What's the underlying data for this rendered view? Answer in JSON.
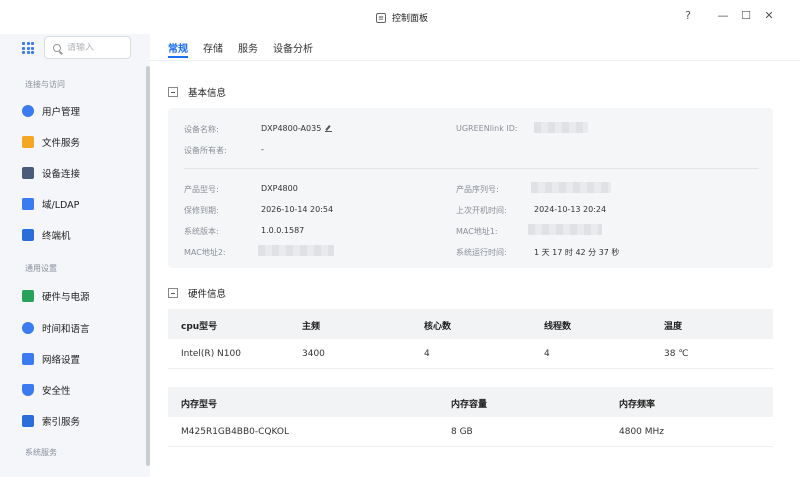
{
  "window": {
    "title": "控制面板"
  },
  "window_controls": {
    "help": "?",
    "minimize": "—",
    "maximize": "☐",
    "close": "✕"
  },
  "sidebar": {
    "search_placeholder": "请输入",
    "sections": [
      {
        "label": "连接与访问",
        "items": [
          {
            "label": "用户管理",
            "icon": "user-icon",
            "color": "#3a7bf0"
          },
          {
            "label": "文件服务",
            "icon": "folder-icon",
            "color": "#f5a623"
          },
          {
            "label": "设备连接",
            "icon": "device-icon",
            "color": "#4a5a7a"
          },
          {
            "label": "域/LDAP",
            "icon": "domain-icon",
            "color": "#3a7bf0"
          },
          {
            "label": "终端机",
            "icon": "terminal-icon",
            "color": "#2b6ed9"
          }
        ]
      },
      {
        "label": "通用设置",
        "items": [
          {
            "label": "硬件与电源",
            "icon": "power-icon",
            "color": "#27a35b"
          },
          {
            "label": "时间和语言",
            "icon": "clock-icon",
            "color": "#3a7bf0"
          },
          {
            "label": "网络设置",
            "icon": "network-icon",
            "color": "#3a7bf0"
          },
          {
            "label": "安全性",
            "icon": "shield-icon",
            "color": "#3a7bf0"
          },
          {
            "label": "索引服务",
            "icon": "index-icon",
            "color": "#2b6ed9"
          }
        ]
      },
      {
        "label": "系统服务",
        "items": []
      }
    ]
  },
  "tabs": [
    {
      "label": "常规",
      "active": true
    },
    {
      "label": "存储",
      "active": false
    },
    {
      "label": "服务",
      "active": false
    },
    {
      "label": "设备分析",
      "active": false
    }
  ],
  "basic_info": {
    "heading": "基本信息",
    "device_name_label": "设备名称:",
    "device_name": "DXP4800-A035",
    "owner_label": "设备所有者:",
    "owner": "-",
    "ugreenlink_label": "UGREENlink ID:",
    "model_label": "产品型号:",
    "model": "DXP4800",
    "warranty_label": "保修到期:",
    "warranty": "2026-10-14 20:54",
    "version_label": "系统版本:",
    "version": "1.0.0.1587",
    "mac2_label": "MAC地址2:",
    "serial_label": "产品序列号:",
    "last_boot_label": "上次开机时间:",
    "last_boot": "2024-10-13 20:24",
    "mac1_label": "MAC地址1:",
    "uptime_label": "系统运行时间:",
    "uptime": "1 天 17 时 42 分 37 秒"
  },
  "hardware_info": {
    "heading": "硬件信息",
    "cpu_table": {
      "headers": [
        "cpu型号",
        "主频",
        "核心数",
        "线程数",
        "温度"
      ],
      "rows": [
        [
          "Intel(R) N100",
          "3400",
          "4",
          "4",
          "38 ℃"
        ]
      ]
    },
    "memory_table": {
      "headers": [
        "内存型号",
        "内存容量",
        "内存频率"
      ],
      "rows": [
        [
          "M425R1GB4BB0-CQKOL",
          "8 GB",
          "4800 MHz"
        ]
      ]
    }
  }
}
